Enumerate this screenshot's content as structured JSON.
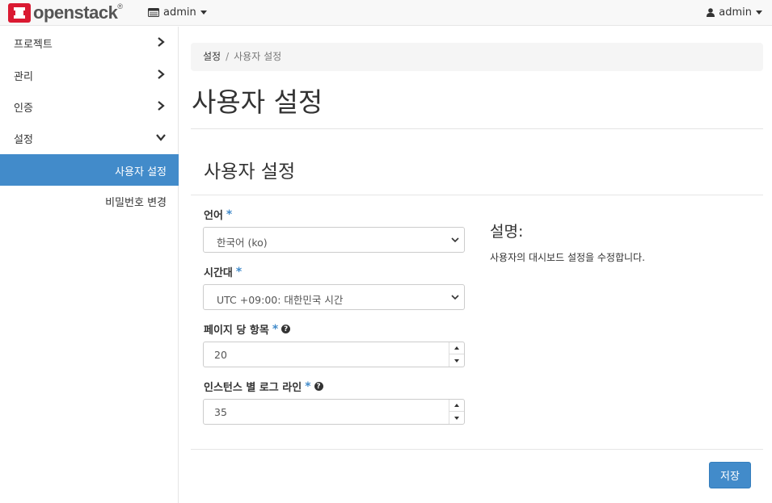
{
  "navbar": {
    "brand": "openstack",
    "brand_mark": "®",
    "project_label": "admin",
    "user_label": "admin",
    "brand_color": "#da1a32"
  },
  "sidebar": {
    "items": [
      {
        "label": "프로젝트",
        "expanded": false
      },
      {
        "label": "관리",
        "expanded": false
      },
      {
        "label": "인증",
        "expanded": false
      },
      {
        "label": "설정",
        "expanded": true
      }
    ],
    "sub_items": [
      {
        "label": "사용자 설정",
        "active": true
      },
      {
        "label": "비밀번호 변경",
        "active": false
      }
    ],
    "active_color": "#428bca"
  },
  "breadcrumb": {
    "parent": "설정",
    "separator": "/",
    "current": "사용자 설정"
  },
  "page": {
    "title": "사용자 설정",
    "section_title": "사용자 설정"
  },
  "form": {
    "language": {
      "label": "언어",
      "required": "*",
      "value": "한국어 (ko)"
    },
    "timezone": {
      "label": "시간대",
      "required": "*",
      "value": "UTC +09:00: 대한민국 시간"
    },
    "page_size": {
      "label": "페이지 당 항목",
      "required": "*",
      "help": "?",
      "value": "20"
    },
    "log_lines": {
      "label": "인스턴스 별 로그 라인",
      "required": "*",
      "help": "?",
      "value": "35"
    }
  },
  "description": {
    "title": "설명:",
    "text": "사용자의 대시보드 설정을 수정합니다."
  },
  "actions": {
    "save_label": "저장"
  }
}
